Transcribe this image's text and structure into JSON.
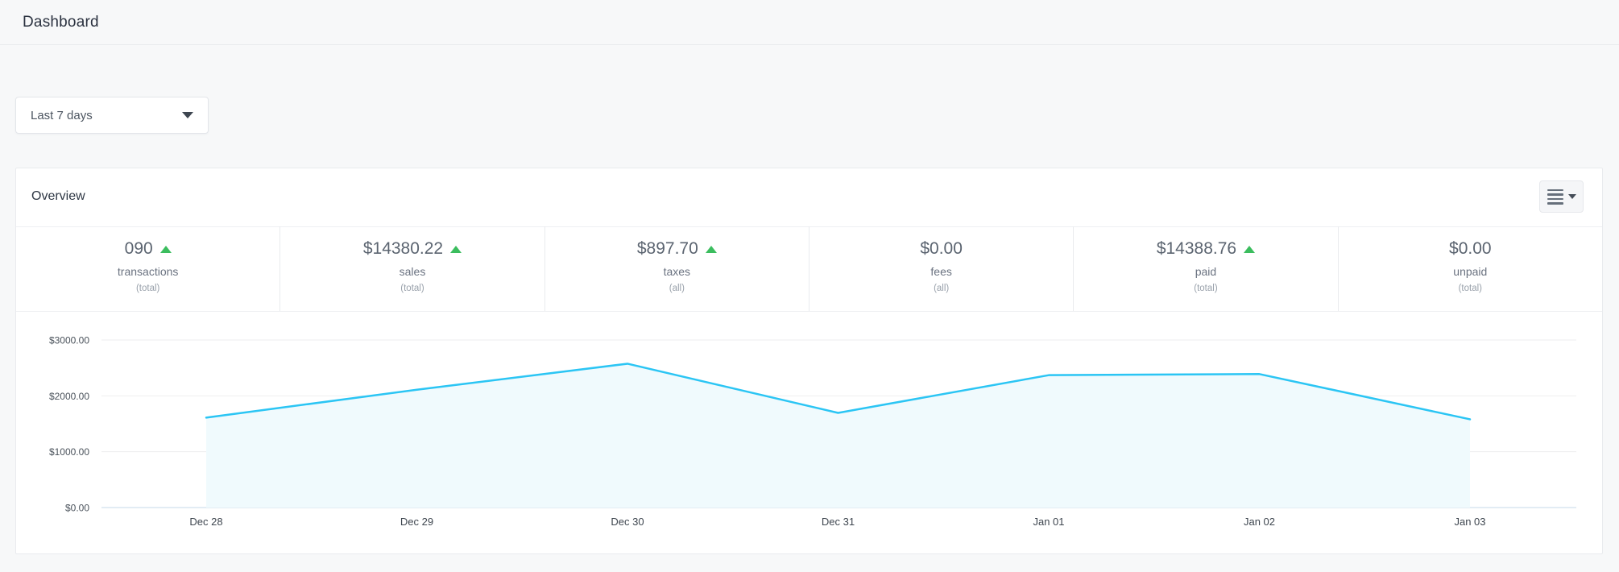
{
  "page": {
    "title": "Dashboard"
  },
  "filter": {
    "selected": "Last 7 days"
  },
  "overview": {
    "title": "Overview",
    "menu_icon": "list-icon"
  },
  "stats": [
    {
      "value": "090",
      "label": "transactions",
      "scope": "(total)",
      "trend": "up"
    },
    {
      "value": "$14380.22",
      "label": "sales",
      "scope": "(total)",
      "trend": "up"
    },
    {
      "value": "$897.70",
      "label": "taxes",
      "scope": "(all)",
      "trend": "up"
    },
    {
      "value": "$0.00",
      "label": "fees",
      "scope": "(all)",
      "trend": null
    },
    {
      "value": "$14388.76",
      "label": "paid",
      "scope": "(total)",
      "trend": "up"
    },
    {
      "value": "$0.00",
      "label": "unpaid",
      "scope": "(total)",
      "trend": null
    }
  ],
  "chart_data": {
    "type": "area",
    "title": "",
    "xlabel": "",
    "ylabel": "",
    "x": [
      "Dec 28",
      "Dec 29",
      "Dec 30",
      "Dec 31",
      "Jan 01",
      "Jan 02",
      "Jan 03"
    ],
    "values": [
      1610,
      2110,
      2575,
      1695,
      2370,
      2390,
      1580
    ],
    "ytick_labels": [
      "$3000.00",
      "$2000.00",
      "$1000.00",
      "$0.00"
    ],
    "ytick_values": [
      3000,
      2000,
      1000,
      0
    ],
    "ylim": [
      0,
      3000
    ],
    "grid": "on",
    "legend": "none",
    "line_color": "#2bc5f4",
    "fill_color": "#f0fafd"
  },
  "colors": {
    "trend_up": "#3bbd5e",
    "accent_line": "#2bc5f4",
    "page_background": "#f7f8f9",
    "card_background": "#ffffff"
  }
}
